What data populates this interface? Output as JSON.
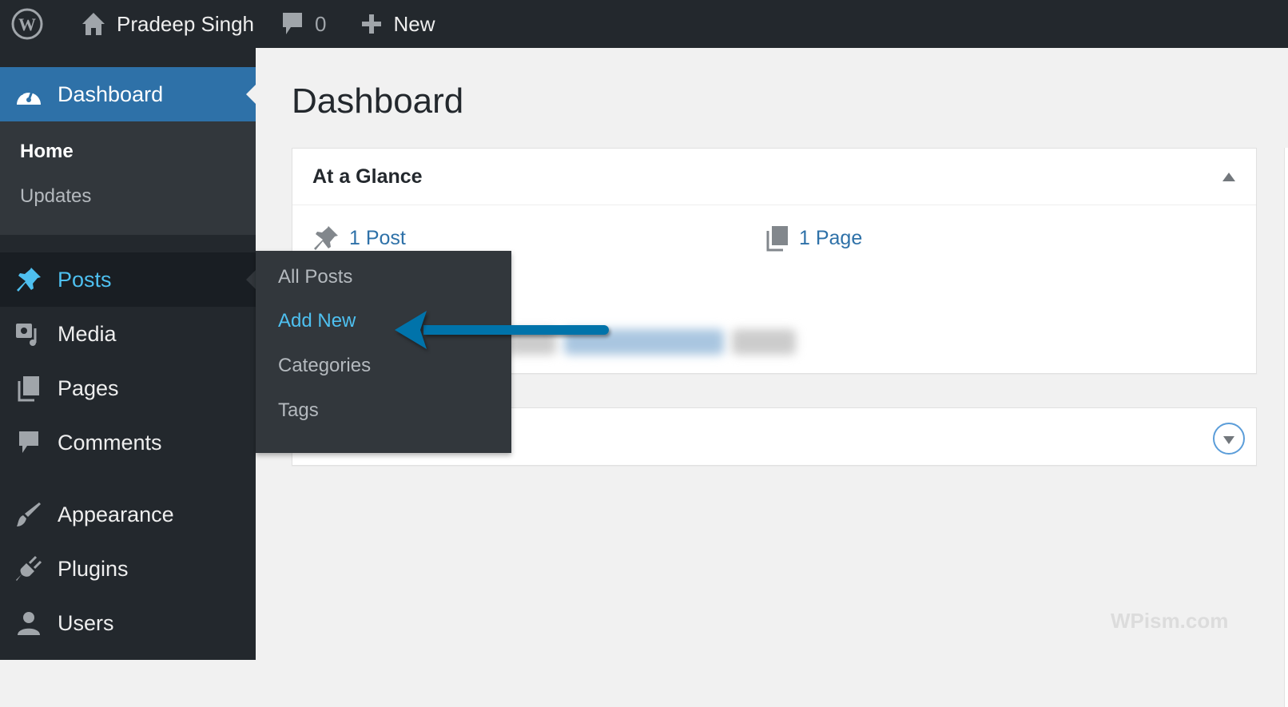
{
  "topbar": {
    "site_name": "Pradeep Singh",
    "comments_count": "0",
    "new_label": "New"
  },
  "sidebar": {
    "dashboard": "Dashboard",
    "home": "Home",
    "updates": "Updates",
    "items": [
      {
        "label": "Posts"
      },
      {
        "label": "Media"
      },
      {
        "label": "Pages"
      },
      {
        "label": "Comments"
      },
      {
        "label": "Appearance"
      },
      {
        "label": "Plugins"
      },
      {
        "label": "Users"
      }
    ]
  },
  "flyout": {
    "items": [
      "All Posts",
      "Add New",
      "Categories",
      "Tags"
    ]
  },
  "main": {
    "title": "Dashboard",
    "glance_title": "At a Glance",
    "posts": "1 Post",
    "pages": "1 Page"
  },
  "watermark": "WPism.com",
  "colors": {
    "accent": "#2e71a8",
    "active": "#4ec0f0",
    "arrow": "#0073aa"
  }
}
